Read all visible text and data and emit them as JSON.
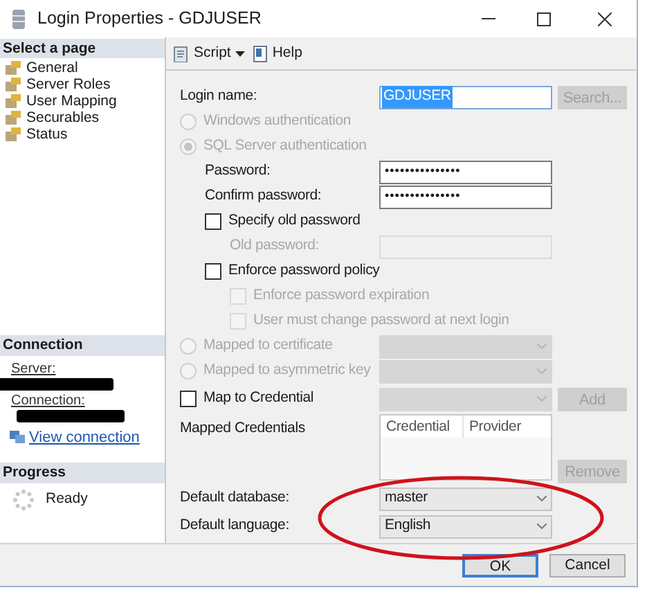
{
  "window": {
    "title": "Login Properties - GDJUSER"
  },
  "sidebar": {
    "header": "Select a page",
    "pages": [
      {
        "label": "General"
      },
      {
        "label": "Server Roles"
      },
      {
        "label": "User Mapping"
      },
      {
        "label": "Securables"
      },
      {
        "label": "Status"
      }
    ]
  },
  "connection": {
    "header": "Connection",
    "server_label": "Server:",
    "connection_label": "Connection:",
    "link": "View connection"
  },
  "progress": {
    "header": "Progress",
    "status": "Ready"
  },
  "toolbar": {
    "script": "Script",
    "help": "Help"
  },
  "form": [
    {
      "kind": "text",
      "label": "Login name:",
      "value": "GDJUSER",
      "value_selected": true,
      "button": {
        "label": "Search...",
        "disabled": true
      }
    },
    {
      "kind": "radio",
      "label": "Windows authentication",
      "checked": false,
      "disabled": true
    },
    {
      "kind": "radio",
      "label": "SQL Server authentication",
      "checked": true,
      "disabled": true,
      "children": [
        {
          "kind": "password",
          "label": "Password:",
          "value": "•••••••••••••••"
        },
        {
          "kind": "password",
          "label": "Confirm password:",
          "value": "•••••••••••••••"
        },
        {
          "kind": "checkbox",
          "label": "Specify old password",
          "checked": false,
          "disabled": false,
          "children": [
            {
              "kind": "password",
              "label": "Old password:",
              "disabled": true
            }
          ]
        },
        {
          "kind": "checkbox",
          "label": "Enforce password policy",
          "checked": false,
          "disabled": false,
          "children": [
            {
              "kind": "checkbox",
              "label": "Enforce password expiration",
              "checked": false,
              "disabled": true
            },
            {
              "kind": "checkbox",
              "label": "User must change password at next login",
              "checked": false,
              "disabled": true
            }
          ]
        }
      ]
    },
    {
      "kind": "radio",
      "label": "Mapped to certificate",
      "checked": false,
      "disabled": true,
      "dropdown": {
        "disabled": true
      }
    },
    {
      "kind": "radio",
      "label": "Mapped to asymmetric key",
      "checked": false,
      "disabled": true,
      "dropdown": {
        "disabled": true
      }
    },
    {
      "kind": "checkbox",
      "label": "Map to Credential",
      "checked": false,
      "disabled": false,
      "dropdown": {
        "disabled": true
      },
      "button": {
        "label": "Add",
        "disabled": true
      }
    },
    {
      "kind": "grid",
      "label": "Mapped Credentials",
      "columns": [
        "Credential",
        "Provider"
      ],
      "button": {
        "label": "Remove",
        "disabled": true
      }
    },
    {
      "kind": "select",
      "label": "Default database:",
      "dropdown": {
        "value": "master",
        "disabled": false
      }
    },
    {
      "kind": "select",
      "label": "Default language:",
      "dropdown": {
        "value": "English",
        "disabled": false
      }
    }
  ],
  "buttons": [
    {
      "label": "OK",
      "default": true
    },
    {
      "label": "Cancel",
      "default": false
    }
  ]
}
